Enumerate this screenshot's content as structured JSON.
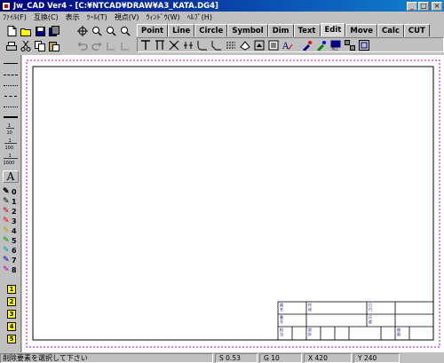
{
  "window": {
    "title": "Jw_CAD Ver4 - [C:¥NTCAD¥DRAW¥A3_KATA.DG4]",
    "minimize_label": "_",
    "maximize_label": "□",
    "close_label": "×"
  },
  "menu": {
    "items": [
      {
        "label": "ﾌｧｲﾙ(F)"
      },
      {
        "label": "互換(C)"
      },
      {
        "label": "表示"
      },
      {
        "label": "ﾂｰﾙ(T)"
      },
      {
        "label": "視点(V)"
      },
      {
        "label": "ｳｨﾝﾄﾞｳ(W)"
      },
      {
        "label": "ﾍﾙﾌﾟ(H)"
      }
    ]
  },
  "tabs": [
    {
      "label": "Point"
    },
    {
      "label": "Line"
    },
    {
      "label": "Circle"
    },
    {
      "label": "Symbol"
    },
    {
      "label": "Dim"
    },
    {
      "label": "Text"
    },
    {
      "label": "Edit",
      "active": true
    },
    {
      "label": "Move"
    },
    {
      "label": "Calc"
    },
    {
      "label": "CUT"
    }
  ],
  "left_panel": {
    "text_tool": "A",
    "scales": [
      "1/10",
      "1/100",
      "1/1000"
    ],
    "pens": [
      "0",
      "1",
      "2",
      "3",
      "4",
      "5",
      "6",
      "7",
      "8"
    ],
    "layers": [
      "1",
      "2",
      "3",
      "4",
      "5"
    ],
    "colors": {
      "pen0": "#ffffff",
      "pen1": "#000000",
      "pen2": "#c00000",
      "pen3": "#ff0000",
      "pen4": "#c0a000",
      "pen5": "#00a000",
      "pen6": "#00a0a0",
      "pen7": "#0000c0",
      "pen8": "#c000c0"
    }
  },
  "title_block": {
    "cells": [
      "図",
      "名",
      "作",
      "成",
      "日",
      "付",
      "番",
      "号",
      "尺",
      "度",
      "担",
      "当",
      "設",
      "計",
      "検",
      "図"
    ]
  },
  "status": {
    "message": "削除要素を選択して下さい",
    "s_label": "S 0.53",
    "g_label": "G 10",
    "x_label": "X 420",
    "y_label": "Y 240"
  }
}
